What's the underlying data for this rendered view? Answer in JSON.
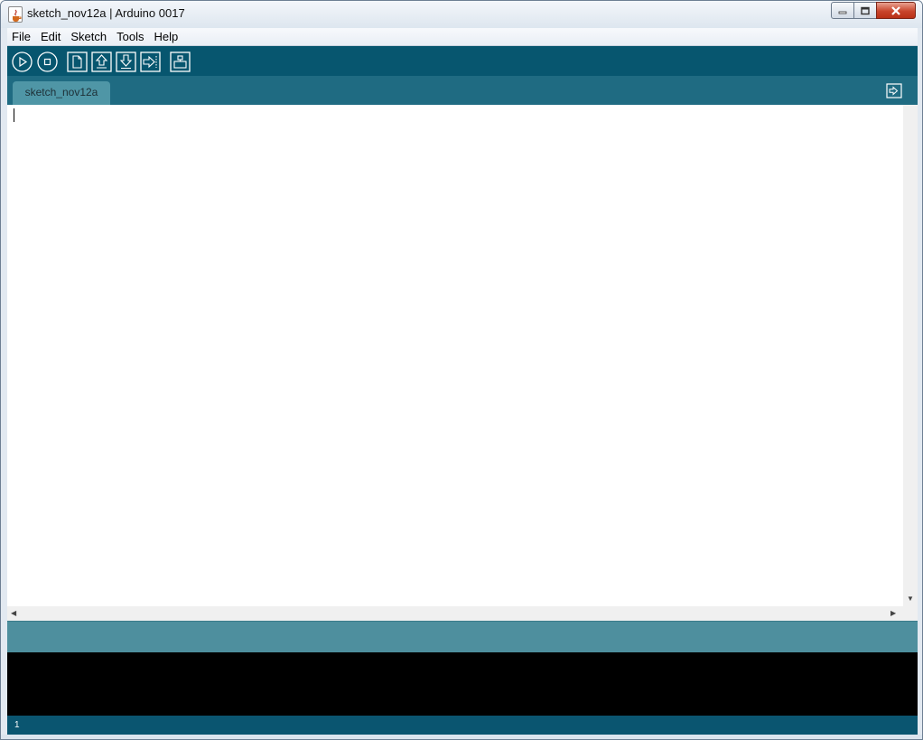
{
  "window": {
    "title": "sketch_nov12a | Arduino 0017",
    "icon": "java-cup-icon"
  },
  "menubar": {
    "items": [
      "File",
      "Edit",
      "Sketch",
      "Tools",
      "Help"
    ]
  },
  "toolbar": {
    "buttons": [
      {
        "name": "verify-button",
        "icon": "play-icon"
      },
      {
        "name": "stop-button",
        "icon": "stop-icon"
      },
      {
        "name": "new-button",
        "icon": "new-file-icon"
      },
      {
        "name": "open-button",
        "icon": "open-up-arrow-icon"
      },
      {
        "name": "save-button",
        "icon": "save-down-arrow-icon"
      },
      {
        "name": "upload-button",
        "icon": "upload-right-arrow-icon"
      },
      {
        "name": "serial-monitor-button",
        "icon": "serial-monitor-icon"
      }
    ]
  },
  "tabs": {
    "active": "sketch_nov12a",
    "menu_icon": "tab-menu-arrow-icon"
  },
  "editor": {
    "content": ""
  },
  "status": {
    "message": ""
  },
  "console": {
    "output": ""
  },
  "footer": {
    "line_number": "1"
  },
  "colors": {
    "toolbar": "#07566f",
    "tabbar": "#1f6b82",
    "tab": "#4f96a6",
    "status": "#4e8f9e",
    "console": "#000000"
  }
}
